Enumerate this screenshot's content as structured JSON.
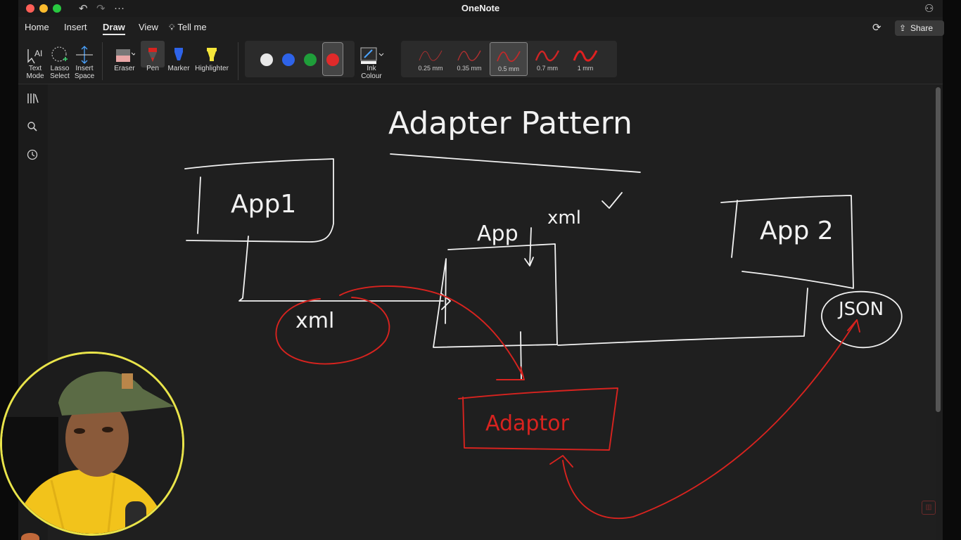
{
  "window": {
    "title": "OneNote"
  },
  "tabs": [
    {
      "label": "Home"
    },
    {
      "label": "Insert"
    },
    {
      "label": "Draw"
    },
    {
      "label": "View"
    },
    {
      "label": "Tell me"
    }
  ],
  "header": {
    "share_label": "Share"
  },
  "ribbon": {
    "text_mode": {
      "line1": "Text",
      "line2": "Mode"
    },
    "lasso_select": {
      "line1": "Lasso",
      "line2": "Select"
    },
    "insert_space": {
      "line1": "Insert",
      "line2": "Space"
    },
    "eraser": "Eraser",
    "pen": "Pen",
    "marker": "Marker",
    "highlighter": "Highlighter",
    "ink_colour": {
      "line1": "Ink",
      "line2": "Colour"
    },
    "palette_colors": [
      "#e8e8e8",
      "#2e63e8",
      "#1f9e3a",
      "#e02a2a"
    ],
    "selected_color": "#e02a2a",
    "stroke_widths": [
      "0.25 mm",
      "0.35 mm",
      "0.5 mm",
      "0.7 mm",
      "1 mm"
    ],
    "selected_width": "0.5 mm"
  },
  "sidebar": {
    "icons": [
      "notebooks-icon",
      "search-icon",
      "recent-icon"
    ]
  },
  "drawing": {
    "title": "Adapter Pattern",
    "app1_label": "App1",
    "app2_label": "App 2",
    "app_label": "App",
    "xml_label_top": "xml",
    "xml_label_circle": "xml",
    "json_label": "JSON",
    "adapter_label": "Adaptor",
    "ink_white": "#f2f2f2",
    "ink_red": "#d8231f"
  }
}
